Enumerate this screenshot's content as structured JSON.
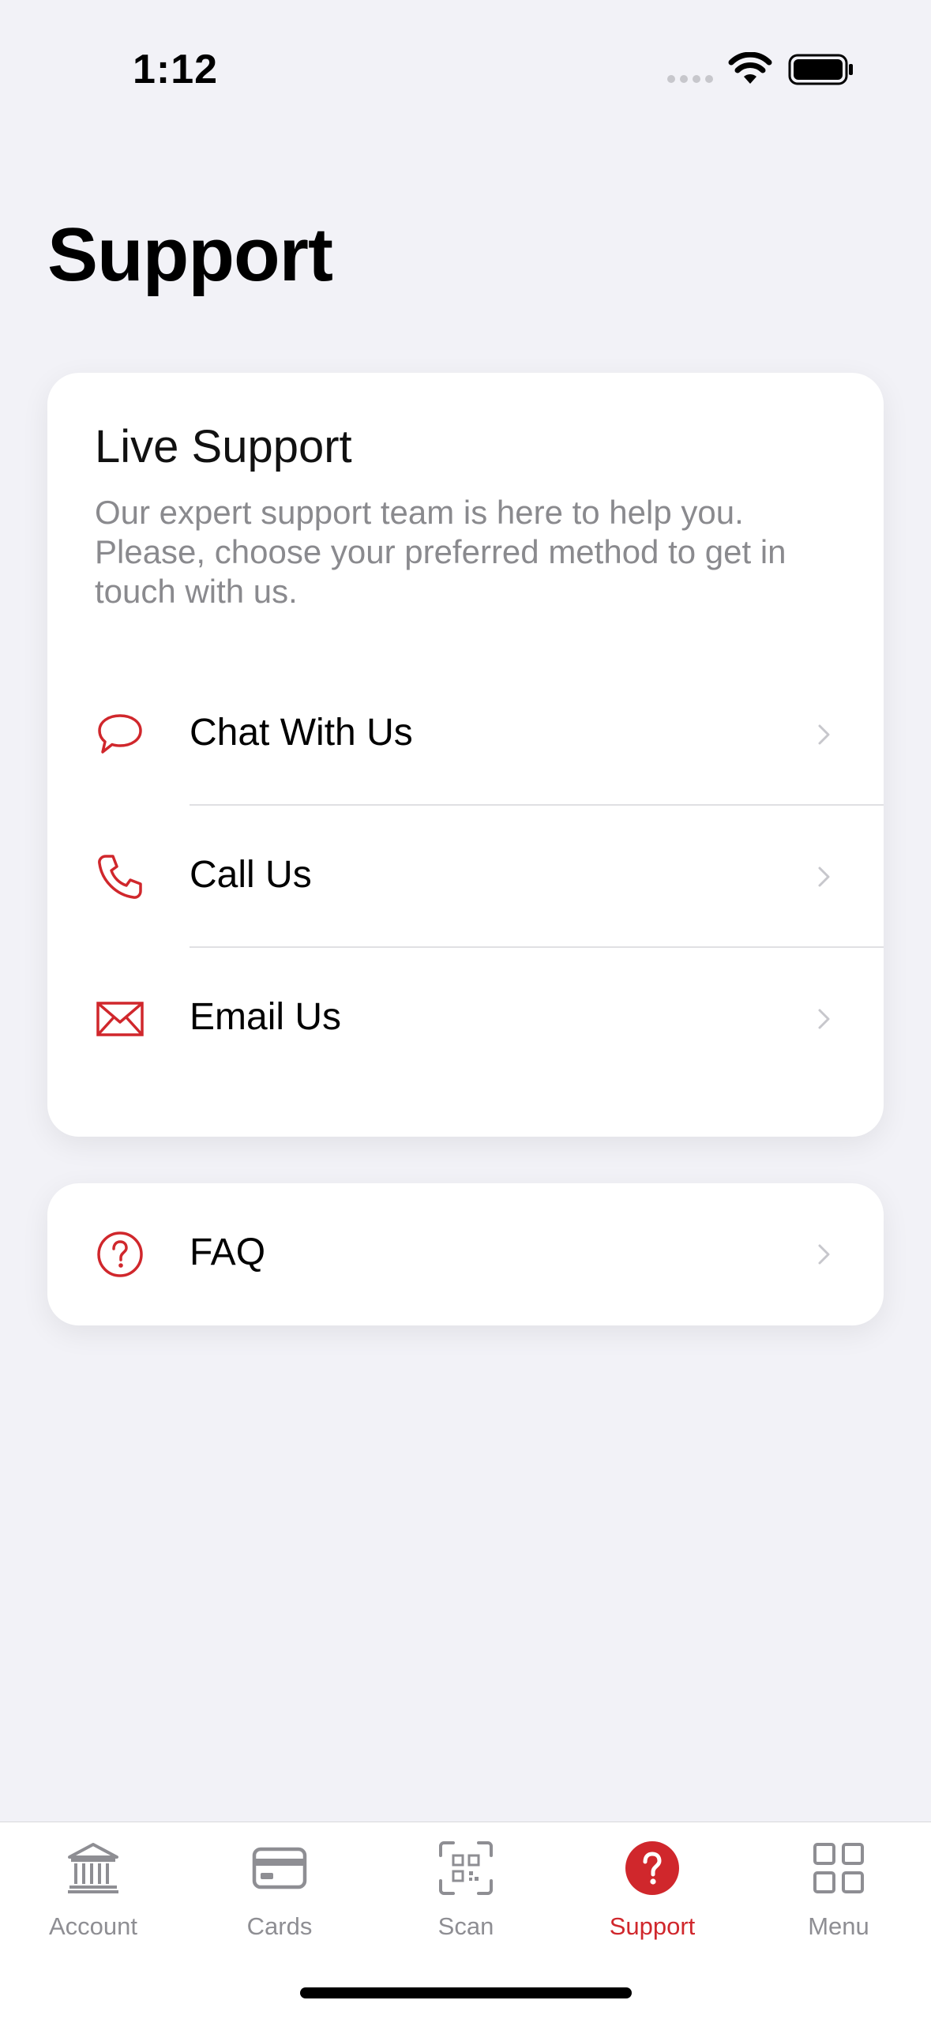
{
  "status_bar": {
    "time": "1:12"
  },
  "page": {
    "title": "Support"
  },
  "live_support": {
    "title": "Live Support",
    "description": "Our expert support team is here to help you. Please, choose your preferred method to get in touch with us.",
    "items": [
      {
        "label": "Chat With Us",
        "icon": "chat-bubble-icon"
      },
      {
        "label": "Call Us",
        "icon": "phone-icon"
      },
      {
        "label": "Email Us",
        "icon": "envelope-icon"
      }
    ]
  },
  "faq": {
    "label": "FAQ",
    "icon": "question-circle-icon"
  },
  "tab_bar": {
    "tabs": [
      {
        "label": "Account",
        "icon": "bank-icon",
        "active": false
      },
      {
        "label": "Cards",
        "icon": "card-icon",
        "active": false
      },
      {
        "label": "Scan",
        "icon": "qr-scan-icon",
        "active": false
      },
      {
        "label": "Support",
        "icon": "question-badge-icon",
        "active": true
      },
      {
        "label": "Menu",
        "icon": "grid-icon",
        "active": false
      }
    ]
  },
  "colors": {
    "accent": "#d0272c",
    "background": "#f2f2f7",
    "muted": "#8e8e93"
  }
}
